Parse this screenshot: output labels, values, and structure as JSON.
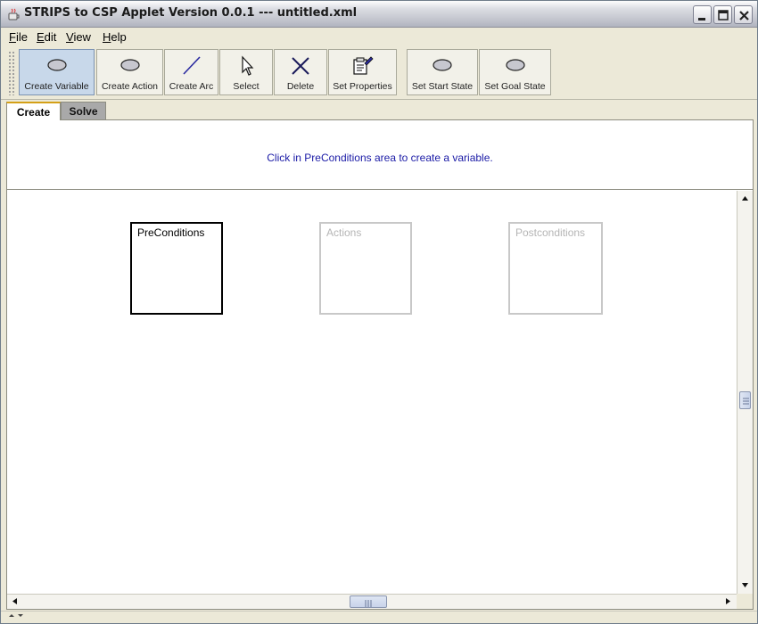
{
  "window": {
    "title": "STRIPS to CSP Applet Version 0.0.1 --- untitled.xml"
  },
  "menu": {
    "items": [
      {
        "label": "File"
      },
      {
        "label": "Edit"
      },
      {
        "label": "View"
      },
      {
        "label": "Help"
      }
    ]
  },
  "toolbar": {
    "buttons": [
      {
        "label": "Create Variable",
        "icon": "ellipse-icon",
        "active": true
      },
      {
        "label": "Create Action",
        "icon": "ellipse-icon",
        "active": false
      },
      {
        "label": "Create Arc",
        "icon": "line-icon",
        "active": false
      },
      {
        "label": "Select",
        "icon": "pointer-icon",
        "active": false
      },
      {
        "label": "Delete",
        "icon": "x-icon",
        "active": false
      },
      {
        "label": "Set Properties",
        "icon": "properties-icon",
        "active": false
      },
      {
        "label": "Set Start State",
        "icon": "ellipse-icon",
        "active": false
      },
      {
        "label": "Set Goal State",
        "icon": "ellipse-icon",
        "active": false
      }
    ]
  },
  "tabs": [
    {
      "label": "Create",
      "selected": true
    },
    {
      "label": "Solve",
      "selected": false
    }
  ],
  "info": {
    "message": "Click in PreConditions area to create a variable.",
    "color": "#1a1aa6"
  },
  "canvas": {
    "boxes": [
      {
        "label": "PreConditions",
        "active": true
      },
      {
        "label": "Actions",
        "active": false
      },
      {
        "label": "Postconditions",
        "active": false
      }
    ]
  }
}
